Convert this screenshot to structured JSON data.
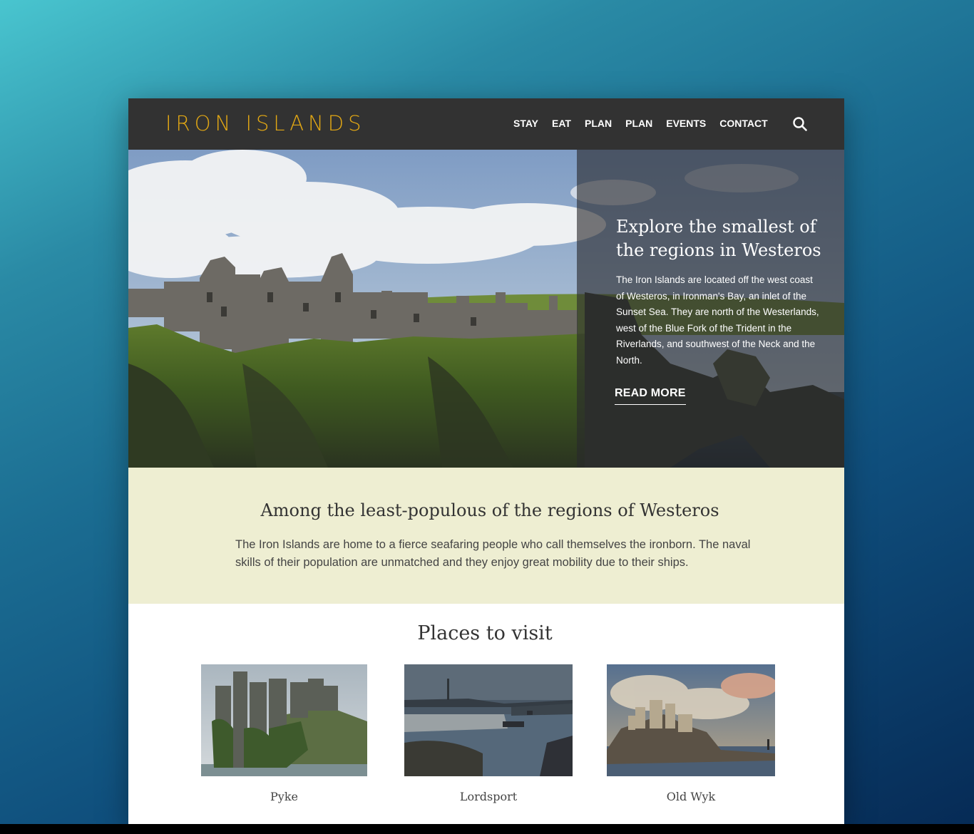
{
  "header": {
    "logo": "IRON ISLANDS",
    "nav": [
      "STAY",
      "EAT",
      "PLAN",
      "PLAN",
      "EVENTS",
      "CONTACT"
    ],
    "search_icon": "search-icon"
  },
  "hero": {
    "title": "Explore the smallest of the regions in Westeros",
    "text": "The Iron Islands are located off the west coast of Westeros, in Ironman's Bay, an inlet of the Sunset Sea. They are north of the Westerlands, west of the Blue Fork of the Trident in the Riverlands, and southwest of the Neck and the North.",
    "cta": "READ MORE"
  },
  "intro": {
    "title": "Among the least-populous of the regions of Westeros",
    "text": "The Iron Islands are home to a fierce seafaring people who call themselves the ironborn. The naval skills of their population are unmatched and they enjoy great mobility due to their ships."
  },
  "places": {
    "title": "Places to visit",
    "items": [
      {
        "name": "Pyke"
      },
      {
        "name": "Lordsport"
      },
      {
        "name": "Old Wyk"
      }
    ]
  },
  "colors": {
    "logo": "#e3a814",
    "header_bg": "#323232",
    "intro_bg": "#eeeed2"
  }
}
